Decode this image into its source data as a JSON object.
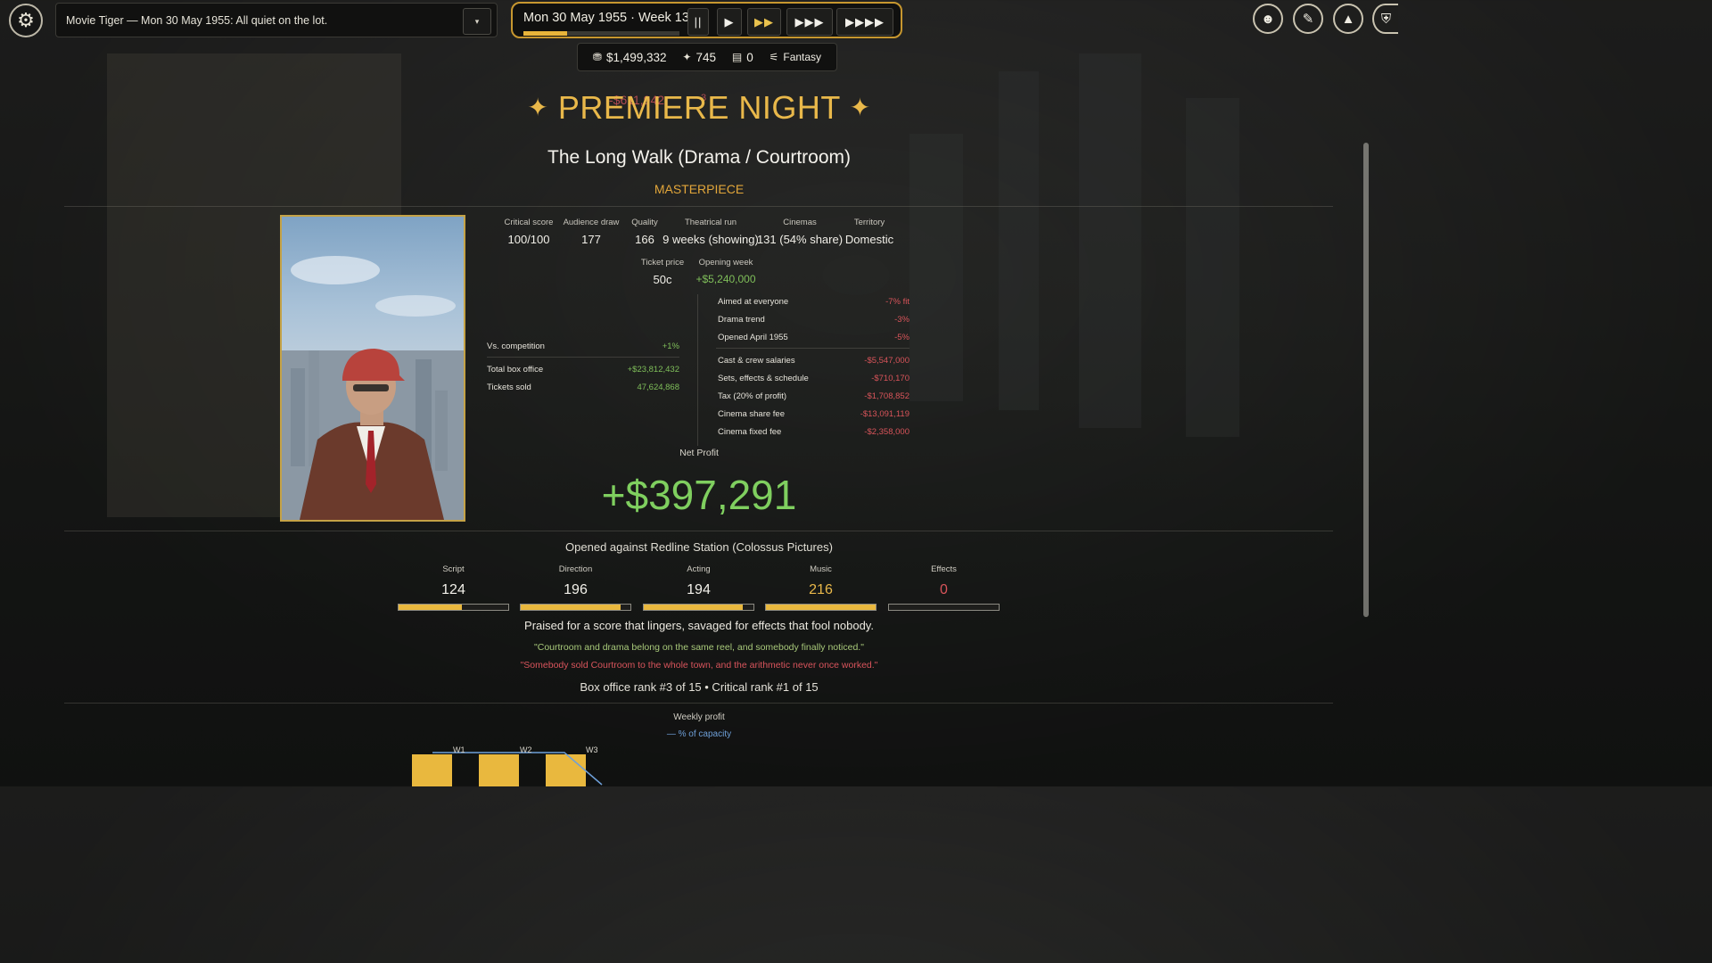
{
  "topbar": {
    "news": "Movie Tiger — Mon 30 May 1955: All quiet on the lot.",
    "dropdown_icon": "▾",
    "date": "Mon 30 May 1955  ·  Week 1326",
    "week_progress": 0.28,
    "speed_buttons": [
      "||",
      "▶",
      "▶▶",
      "▶▶▶",
      "▶▶▶▶"
    ]
  },
  "stats": {
    "money": "$1,499,332",
    "fans": "745",
    "films": "0",
    "genre": "Fantasy"
  },
  "ghost_text": {
    "amount": "-$611,942",
    "mark": "3"
  },
  "premiere": {
    "title": "PREMIERE NIGHT",
    "movie": "The Long Walk  (Drama / Courtroom)",
    "tier": "MASTERPIECE"
  },
  "metrics": {
    "headers": [
      "Critical score",
      "Audience draw",
      "Quality",
      "Theatrical run",
      "Cinemas",
      "Territory"
    ],
    "values": [
      "100/100",
      "177",
      "166",
      "9 weeks (showing)",
      "131 (54% share)",
      "Domestic"
    ],
    "ticket_label": "Ticket price",
    "ticket_value": "50c",
    "opening_label": "Opening week",
    "opening_value": "+$5,240,000"
  },
  "left_rows": [
    {
      "label": "Vs. competition",
      "value": "+1%"
    },
    {
      "label": "Total box office",
      "value": "+$23,812,432"
    },
    {
      "label": "Tickets sold",
      "value": "47,624,868"
    }
  ],
  "modifiers": [
    {
      "label": "Aimed at everyone",
      "value": "-7% fit"
    },
    {
      "label": "Drama trend",
      "value": "-3%"
    },
    {
      "label": "Opened April 1955",
      "value": "-5%"
    }
  ],
  "costs": [
    {
      "label": "Cast & crew salaries",
      "value": "-$5,547,000"
    },
    {
      "label": "Sets, effects & schedule",
      "value": "-$710,170"
    },
    {
      "label": "Tax (20% of profit)",
      "value": "-$1,708,852"
    },
    {
      "label": "Cinema share fee",
      "value": "-$13,091,119"
    },
    {
      "label": "Cinema fixed fee",
      "value": "-$2,358,000"
    }
  ],
  "net": {
    "label": "Net Profit",
    "value": "+$397,291"
  },
  "opened_against": "Opened against Redline Station (Colossus Pictures)",
  "scores": [
    {
      "label": "Script",
      "value": "124",
      "fill": 0.58,
      "color": "#f3f1ea"
    },
    {
      "label": "Direction",
      "value": "196",
      "fill": 0.91,
      "color": "#f3f1ea"
    },
    {
      "label": "Acting",
      "value": "194",
      "fill": 0.9,
      "color": "#f3f1ea"
    },
    {
      "label": "Music",
      "value": "216",
      "fill": 1.0,
      "color": "#e9b84a"
    },
    {
      "label": "Effects",
      "value": "0",
      "fill": 0.0,
      "color": "#d8545a"
    }
  ],
  "praise": "Praised for a score that lingers, savaged for effects that fool nobody.",
  "quote_good": "\"Courtroom and drama belong on the same reel, and somebody finally noticed.\"",
  "quote_bad": "\"Somebody sold Courtroom to the whole town, and the arithmetic never once worked.\"",
  "ranks": "Box office rank #3 of 15   •   Critical rank #1 of 15",
  "chart": {
    "title": "Weekly profit",
    "legend": "— % of capacity",
    "weeks": [
      "W1",
      "W2",
      "W3"
    ],
    "bar_color": "#e9b83e",
    "line_color": "#6e9fd8"
  }
}
